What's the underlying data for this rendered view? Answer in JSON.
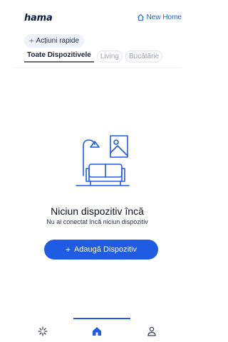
{
  "header": {
    "brand": "hama",
    "home_label": "New Home",
    "home_icon": "home-outline-icon"
  },
  "quick_actions": {
    "plus": "+",
    "label": "Acțiuni rapide"
  },
  "tabs": [
    {
      "label": "Toate Dispozitivele",
      "active": true
    },
    {
      "label": "Living",
      "active": false
    },
    {
      "label": "Bucătărie",
      "active": false
    }
  ],
  "empty_state": {
    "illustration": "living-room-icon",
    "title": "Niciun dispozitiv încă",
    "subtitle": "Nu ai conectat încă niciun dispozitiv",
    "button_plus": "+",
    "button_label": "Adaugă Dispozitiv"
  },
  "bottom_nav": {
    "items": [
      {
        "icon": "scenes-icon",
        "active": false
      },
      {
        "icon": "home-icon",
        "active": true
      },
      {
        "icon": "profile-icon",
        "active": false
      }
    ]
  },
  "colors": {
    "accent": "#1f5be3",
    "brand": "#0b1a43",
    "muted": "#9aa3b2"
  }
}
